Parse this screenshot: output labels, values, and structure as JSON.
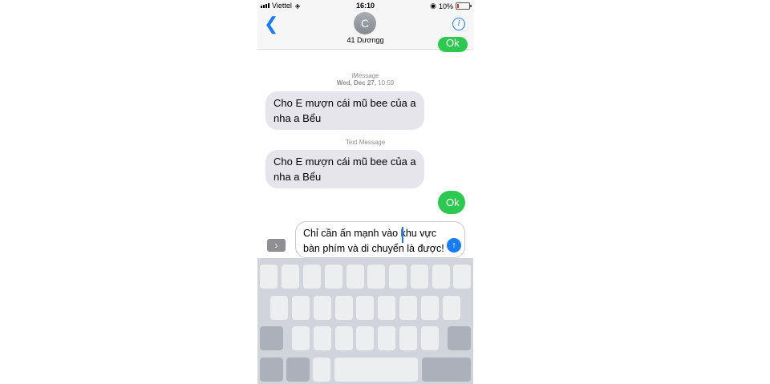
{
  "status_bar": {
    "carrier": "Viettel",
    "time": "16:10",
    "battery": "10%"
  },
  "header": {
    "avatar_initial": "C",
    "contact_name": "41 Dươngg",
    "back_icon": "chevron-left-icon",
    "info_icon": "info-icon"
  },
  "conversation": {
    "partial_sent": "Ok",
    "service_label_1": "iMessage",
    "date_label": "Wed, Dec 27,",
    "date_time": "10:59",
    "msg1_line1": "Cho E mượn cái mũ bee của a",
    "msg1_line2": "nha a Bểu",
    "service_label_2": "Text Message",
    "msg2_line1": "Cho E mượn cái mũ bee của a",
    "msg2_line2": "nha a Bểu",
    "sent_reply": "Ok"
  },
  "compose": {
    "line1": "Chỉ cần ấn mạnh vào khu vực",
    "line2": "bàn phím và di chuyển là được!",
    "expand_icon": "chevron-right-icon",
    "send_icon": "arrow-up-icon"
  },
  "colors": {
    "accent": "#1a7cf5",
    "sent_bubble": "#2dc84f",
    "received_bubble": "#e6e5eb",
    "keyboard": "#d1d4da"
  }
}
